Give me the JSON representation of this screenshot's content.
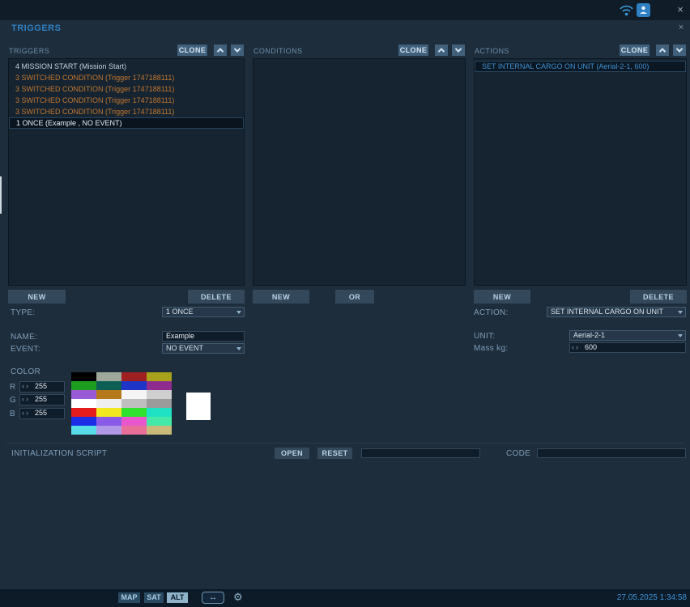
{
  "titlebar": {
    "close": "×"
  },
  "dialog": {
    "title": "TRIGGERS",
    "close": "×"
  },
  "columns": {
    "triggers": {
      "header": "TRIGGERS",
      "clone_label": "CLONE",
      "items": [
        {
          "label": "4 MISSION START (Mission Start)",
          "tone": "normal",
          "selected": false
        },
        {
          "label": "3 SWITCHED CONDITION (Trigger 1747188111)",
          "tone": "orange",
          "selected": false
        },
        {
          "label": "3 SWITCHED CONDITION (Trigger 1747188111)",
          "tone": "orange",
          "selected": false
        },
        {
          "label": "3 SWITCHED CONDITION (Trigger 1747188111)",
          "tone": "orange",
          "selected": false
        },
        {
          "label": "3 SWITCHED CONDITION (Trigger 1747188111)",
          "tone": "orange",
          "selected": false
        },
        {
          "label": "1 ONCE (Example , NO EVENT)",
          "tone": "normal",
          "selected": true
        }
      ],
      "buttons": [
        "NEW",
        "DELETE"
      ]
    },
    "conditions": {
      "header": "CONDITIONS",
      "clone_label": "CLONE",
      "items": [],
      "buttons": [
        "NEW",
        "OR"
      ]
    },
    "actions": {
      "header": "ACTIONS",
      "clone_label": "CLONE",
      "items": [
        {
          "label": "SET INTERNAL CARGO ON UNIT (Aerial-2-1, 600)",
          "tone": "blue",
          "selected": true
        }
      ],
      "buttons": [
        "NEW",
        "DELETE"
      ]
    }
  },
  "form": {
    "type_label": "TYPE:",
    "type_value": "1 ONCE",
    "name_label": "NAME:",
    "name_value": "Example",
    "event_label": "EVENT:",
    "event_value": "NO EVENT",
    "action_label": "ACTION:",
    "action_value": "SET INTERNAL CARGO ON UNIT",
    "unit_label": "UNIT:",
    "unit_value": "Aerial-2-1",
    "mass_label": "Mass kg:",
    "mass_value": "600"
  },
  "color_section": {
    "label": "COLOR",
    "r_label": "R",
    "r_value": "255",
    "g_label": "G",
    "g_value": "255",
    "b_label": "B",
    "b_value": "255",
    "preview": "#ffffff",
    "palette": [
      [
        "#000000",
        "#9fa99b",
        "#9e2020",
        "#a8a11b"
      ],
      [
        "#1e9e1e",
        "#0b5f55",
        "#1f35c8",
        "#8e2b8e"
      ],
      [
        "#9a5ad6",
        "#b5791b",
        "#f5f5f5",
        "#cfcfcf"
      ],
      [
        "#ffffff",
        "#efefef",
        "#bfbfbf",
        "#9b9b9b"
      ],
      [
        "#e51c1c",
        "#f2e81f",
        "#2ee22e",
        "#1fe2c4"
      ],
      [
        "#1c2ee5",
        "#8a5ae8",
        "#e858cc",
        "#44e8a8"
      ],
      [
        "#58dce8",
        "#b09ae8",
        "#e87098",
        "#c9b97a"
      ]
    ]
  },
  "init_script": {
    "label": "INITIALIZATION SCRIPT",
    "open_label": "OPEN",
    "reset_label": "RESET",
    "script_value": "",
    "code_label": "CODE",
    "code_value": ""
  },
  "bottombar": {
    "map_label": "MAP",
    "sat_label": "SAT",
    "alt_label": "ALT",
    "datetime": "27.05.2025 1:34:58"
  },
  "colors": {
    "accent": "#2f81c4",
    "orange_item": "#c0762f",
    "blue_item": "#418fd0",
    "panel": "#1e2d3b",
    "listbox": "#162431"
  }
}
